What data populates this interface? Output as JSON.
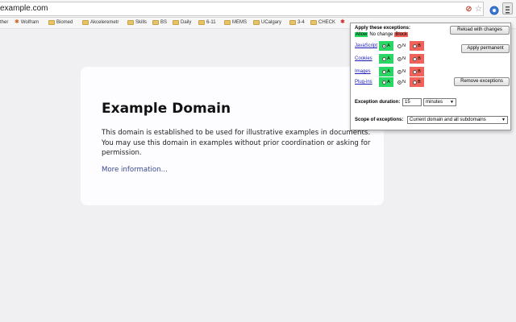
{
  "address_bar": {
    "url": "example.com"
  },
  "toolbar_icons": {
    "left": "page-action-icon",
    "middle": "star-icon",
    "ext1": "extension-icon",
    "ext2": "menu-icon"
  },
  "bookmarks": [
    {
      "label": "ther",
      "icon": "none"
    },
    {
      "label": "Wolfram",
      "icon": "star"
    },
    {
      "label": "Biomed",
      "icon": "folder"
    },
    {
      "label": "Akceleremetr",
      "icon": "folder"
    },
    {
      "label": "Skills",
      "icon": "folder"
    },
    {
      "label": "BS",
      "icon": "folder"
    },
    {
      "label": "Daily",
      "icon": "folder"
    },
    {
      "label": "6-11",
      "icon": "folder"
    },
    {
      "label": "MEMS",
      "icon": "folder"
    },
    {
      "label": "UCalgary",
      "icon": "folder"
    },
    {
      "label": "3-4",
      "icon": "folder"
    },
    {
      "label": "CHECK",
      "icon": "folder"
    }
  ],
  "page": {
    "heading": "Example Domain",
    "body": "This domain is established to be used for illustrative examples in documents. You may use this domain in examples without prior coordination or asking for permission.",
    "link": "More information..."
  },
  "popup": {
    "title": "Apply these exceptions:",
    "legend_allow": "Allow",
    "legend_nochange": "No change",
    "legend_block": "Block",
    "reload_button": "Reload with changes",
    "permanent_button": "Apply permanent",
    "remove_button": "Remove exceptions",
    "rows": [
      {
        "label": "JavaScript",
        "selected": "A"
      },
      {
        "label": "Cookies",
        "selected": "N"
      },
      {
        "label": "Images",
        "selected": "N"
      },
      {
        "label": "Plug-ins",
        "selected": "N"
      }
    ],
    "opt_a": "A",
    "opt_n": "N",
    "opt_b": "B",
    "duration_label": "Exception duration:",
    "duration_value": "15",
    "duration_unit": "minutes",
    "scope_label": "Scope of exceptions:",
    "scope_value": "Current domain and all subdomains"
  },
  "colors": {
    "allow": "#2ad664",
    "block": "#f0625a",
    "link": "#38488f"
  }
}
